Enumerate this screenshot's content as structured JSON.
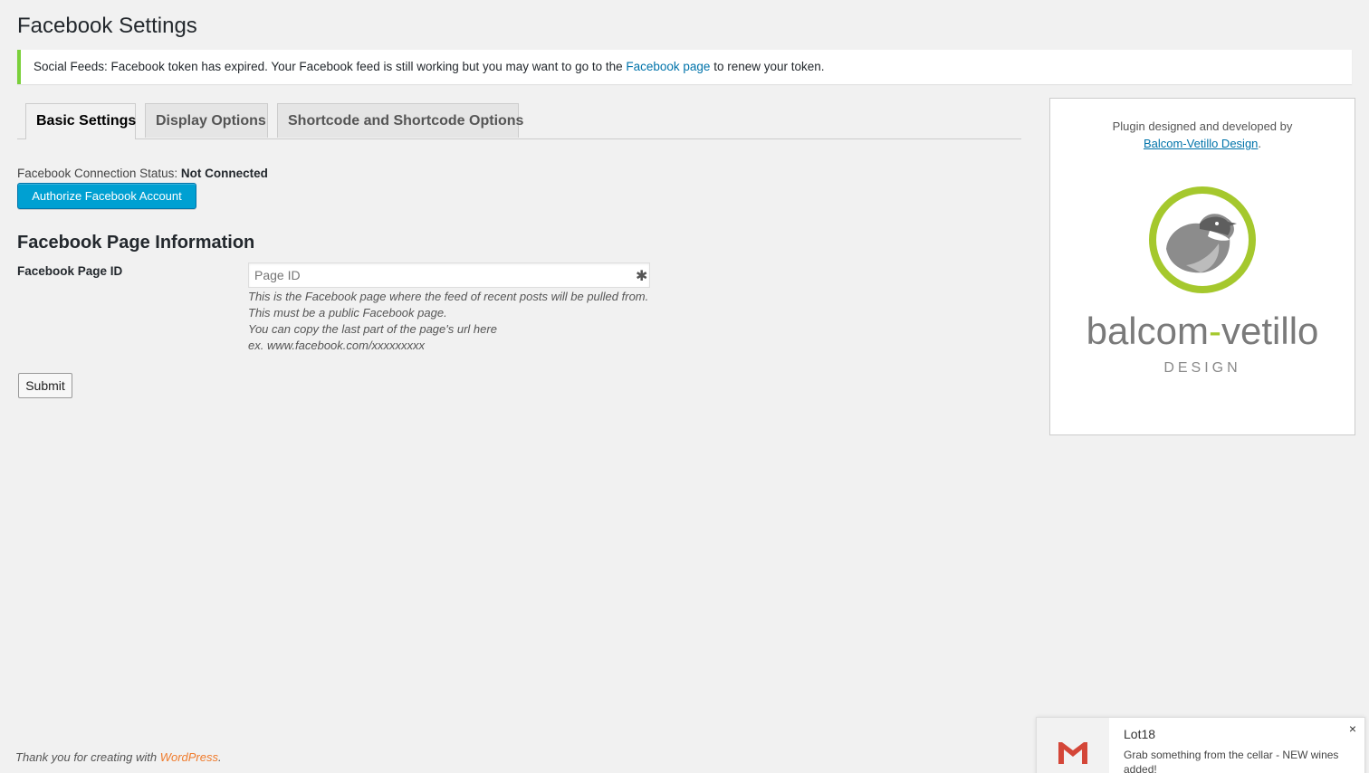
{
  "page": {
    "title": "Facebook Settings"
  },
  "notice": {
    "text_before": "Social Feeds: Facebook token has expired. Your Facebook feed is still working but you may want to go to the ",
    "link_text": "Facebook page",
    "text_after": " to renew your token.",
    "accent_color": "#7ad03a"
  },
  "tabs": [
    {
      "label": "Basic Settings",
      "active": true
    },
    {
      "label": "Display Options",
      "active": false
    },
    {
      "label": "Shortcode and Shortcode Options",
      "active": false
    }
  ],
  "connection": {
    "label": "Facebook Connection Status: ",
    "value": "Not Connected",
    "authorize_button": "Authorize Facebook Account"
  },
  "page_info": {
    "section_title": "Facebook Page Information",
    "field_label": "Facebook Page ID",
    "input_value": "",
    "input_placeholder": "Page ID",
    "required_icon": "asterisk-icon",
    "help_lines": [
      "This is the Facebook page where the feed of recent posts will be pulled from.",
      "This must be a public Facebook page.",
      "You can copy the last part of the page's url here",
      "ex. www.facebook.com/xxxxxxxxx"
    ],
    "submit_label": "Submit"
  },
  "sidebar": {
    "credit_text": "Plugin designed and developed by",
    "credit_link": "Balcom-Vetillo Design",
    "credit_period": ".",
    "logo_word_left": "balcom",
    "logo_word_dash": "-",
    "logo_word_right": "vetillo",
    "logo_subtitle": "DESIGN",
    "logo_accent_color": "#a5c82d"
  },
  "footer": {
    "text": "Thank you for creating with ",
    "link": "WordPress",
    "period": "."
  },
  "notification": {
    "icon": "gmail-icon",
    "title": "Lot18",
    "body": "Grab something from the cellar - NEW wines added!",
    "close_label": "×"
  }
}
